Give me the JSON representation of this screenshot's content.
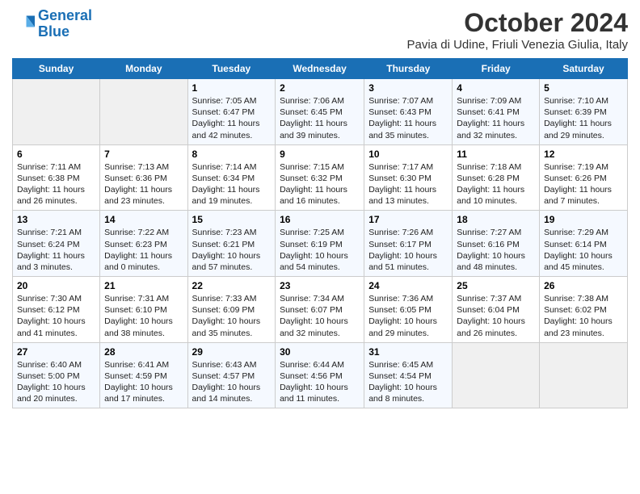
{
  "header": {
    "logo_line1": "General",
    "logo_line2": "Blue",
    "month": "October 2024",
    "location": "Pavia di Udine, Friuli Venezia Giulia, Italy"
  },
  "weekdays": [
    "Sunday",
    "Monday",
    "Tuesday",
    "Wednesday",
    "Thursday",
    "Friday",
    "Saturday"
  ],
  "weeks": [
    [
      {
        "day": "",
        "text": ""
      },
      {
        "day": "",
        "text": ""
      },
      {
        "day": "1",
        "text": "Sunrise: 7:05 AM\nSunset: 6:47 PM\nDaylight: 11 hours and 42 minutes."
      },
      {
        "day": "2",
        "text": "Sunrise: 7:06 AM\nSunset: 6:45 PM\nDaylight: 11 hours and 39 minutes."
      },
      {
        "day": "3",
        "text": "Sunrise: 7:07 AM\nSunset: 6:43 PM\nDaylight: 11 hours and 35 minutes."
      },
      {
        "day": "4",
        "text": "Sunrise: 7:09 AM\nSunset: 6:41 PM\nDaylight: 11 hours and 32 minutes."
      },
      {
        "day": "5",
        "text": "Sunrise: 7:10 AM\nSunset: 6:39 PM\nDaylight: 11 hours and 29 minutes."
      }
    ],
    [
      {
        "day": "6",
        "text": "Sunrise: 7:11 AM\nSunset: 6:38 PM\nDaylight: 11 hours and 26 minutes."
      },
      {
        "day": "7",
        "text": "Sunrise: 7:13 AM\nSunset: 6:36 PM\nDaylight: 11 hours and 23 minutes."
      },
      {
        "day": "8",
        "text": "Sunrise: 7:14 AM\nSunset: 6:34 PM\nDaylight: 11 hours and 19 minutes."
      },
      {
        "day": "9",
        "text": "Sunrise: 7:15 AM\nSunset: 6:32 PM\nDaylight: 11 hours and 16 minutes."
      },
      {
        "day": "10",
        "text": "Sunrise: 7:17 AM\nSunset: 6:30 PM\nDaylight: 11 hours and 13 minutes."
      },
      {
        "day": "11",
        "text": "Sunrise: 7:18 AM\nSunset: 6:28 PM\nDaylight: 11 hours and 10 minutes."
      },
      {
        "day": "12",
        "text": "Sunrise: 7:19 AM\nSunset: 6:26 PM\nDaylight: 11 hours and 7 minutes."
      }
    ],
    [
      {
        "day": "13",
        "text": "Sunrise: 7:21 AM\nSunset: 6:24 PM\nDaylight: 11 hours and 3 minutes."
      },
      {
        "day": "14",
        "text": "Sunrise: 7:22 AM\nSunset: 6:23 PM\nDaylight: 11 hours and 0 minutes."
      },
      {
        "day": "15",
        "text": "Sunrise: 7:23 AM\nSunset: 6:21 PM\nDaylight: 10 hours and 57 minutes."
      },
      {
        "day": "16",
        "text": "Sunrise: 7:25 AM\nSunset: 6:19 PM\nDaylight: 10 hours and 54 minutes."
      },
      {
        "day": "17",
        "text": "Sunrise: 7:26 AM\nSunset: 6:17 PM\nDaylight: 10 hours and 51 minutes."
      },
      {
        "day": "18",
        "text": "Sunrise: 7:27 AM\nSunset: 6:16 PM\nDaylight: 10 hours and 48 minutes."
      },
      {
        "day": "19",
        "text": "Sunrise: 7:29 AM\nSunset: 6:14 PM\nDaylight: 10 hours and 45 minutes."
      }
    ],
    [
      {
        "day": "20",
        "text": "Sunrise: 7:30 AM\nSunset: 6:12 PM\nDaylight: 10 hours and 41 minutes."
      },
      {
        "day": "21",
        "text": "Sunrise: 7:31 AM\nSunset: 6:10 PM\nDaylight: 10 hours and 38 minutes."
      },
      {
        "day": "22",
        "text": "Sunrise: 7:33 AM\nSunset: 6:09 PM\nDaylight: 10 hours and 35 minutes."
      },
      {
        "day": "23",
        "text": "Sunrise: 7:34 AM\nSunset: 6:07 PM\nDaylight: 10 hours and 32 minutes."
      },
      {
        "day": "24",
        "text": "Sunrise: 7:36 AM\nSunset: 6:05 PM\nDaylight: 10 hours and 29 minutes."
      },
      {
        "day": "25",
        "text": "Sunrise: 7:37 AM\nSunset: 6:04 PM\nDaylight: 10 hours and 26 minutes."
      },
      {
        "day": "26",
        "text": "Sunrise: 7:38 AM\nSunset: 6:02 PM\nDaylight: 10 hours and 23 minutes."
      }
    ],
    [
      {
        "day": "27",
        "text": "Sunrise: 6:40 AM\nSunset: 5:00 PM\nDaylight: 10 hours and 20 minutes."
      },
      {
        "day": "28",
        "text": "Sunrise: 6:41 AM\nSunset: 4:59 PM\nDaylight: 10 hours and 17 minutes."
      },
      {
        "day": "29",
        "text": "Sunrise: 6:43 AM\nSunset: 4:57 PM\nDaylight: 10 hours and 14 minutes."
      },
      {
        "day": "30",
        "text": "Sunrise: 6:44 AM\nSunset: 4:56 PM\nDaylight: 10 hours and 11 minutes."
      },
      {
        "day": "31",
        "text": "Sunrise: 6:45 AM\nSunset: 4:54 PM\nDaylight: 10 hours and 8 minutes."
      },
      {
        "day": "",
        "text": ""
      },
      {
        "day": "",
        "text": ""
      }
    ]
  ]
}
